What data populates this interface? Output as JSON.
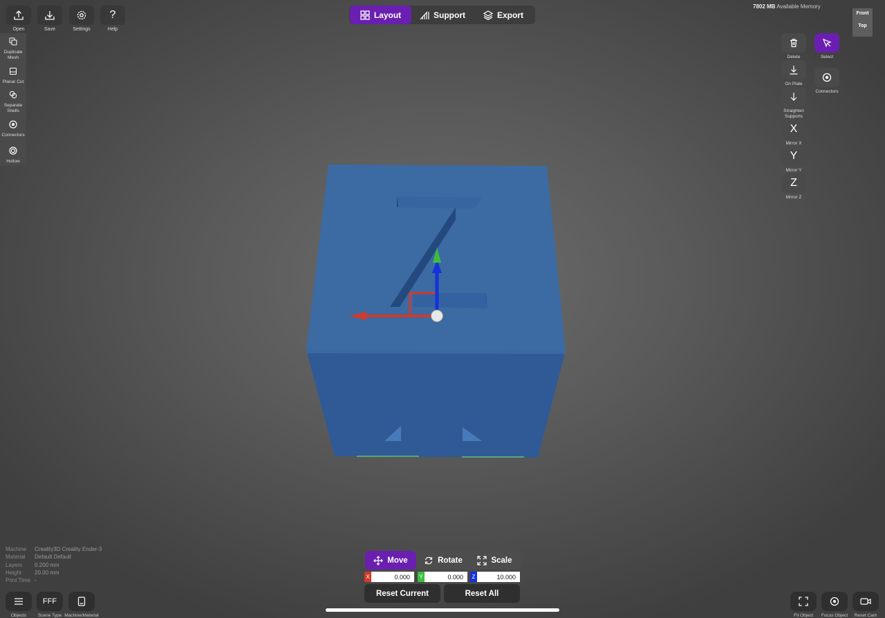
{
  "toolbar": {
    "open": "Open",
    "save": "Save",
    "settings": "Settings",
    "help": "Help"
  },
  "side_panel": {
    "duplicate_mesh": "Duplicate Mesh",
    "planar_cut": "Planar Cut",
    "separate_shells": "Separate Shells",
    "connectors": "Connectors",
    "hollow": "Hollow"
  },
  "tabs": {
    "layout": "Layout",
    "support": "Support",
    "export": "Export"
  },
  "memory": {
    "value": "7802 MB",
    "label": "Available Memory"
  },
  "view_cube": {
    "front": "Front",
    "top": "Top"
  },
  "right_tools": {
    "delete": "Delete",
    "select": "Select",
    "on_plate": "On Plate",
    "connectors": "Connectors",
    "straighten_supports": "Straighten Supports",
    "mirror_x_glyph": "X",
    "mirror_x": "Mirror X",
    "mirror_y_glyph": "Y",
    "mirror_y": "Mirror Y",
    "mirror_z_glyph": "Z",
    "mirror_z": "Mirror Z"
  },
  "info": {
    "machine_label": "Machine",
    "machine_value": "Creality3D Creality Ender-3",
    "material_label": "Material",
    "material_value": "Default Default",
    "layers_label": "Layers",
    "layers_value": "0.200 mm",
    "height_label": "Height",
    "height_value": "20.00 mm",
    "print_time_label": "Print Time",
    "print_time_value": "-"
  },
  "transform": {
    "move": "Move",
    "rotate": "Rotate",
    "scale": "Scale",
    "x_tag": "X",
    "y_tag": "Y",
    "z_tag": "Z",
    "x_value": "0.000",
    "y_value": "0.000",
    "z_value": "10.000",
    "reset_current": "Reset Current",
    "reset_all": "Reset All"
  },
  "bottom_left": {
    "objects": "Objects",
    "scene_type_glyph": "FFF",
    "scene_type": "Scene Type",
    "machine_material": "Machine/Material"
  },
  "bottom_right": {
    "fit_object": "Fit Object",
    "focus_object": "Focus Object",
    "reset_cam": "Reset Cam"
  },
  "colors": {
    "accent": "#6a1fb0",
    "cube_top": "#3c6aa3",
    "cube_front": "#2f5a96",
    "axis_x": "#d23a2a",
    "axis_y": "#3cbf3c",
    "axis_z": "#1432d8"
  }
}
